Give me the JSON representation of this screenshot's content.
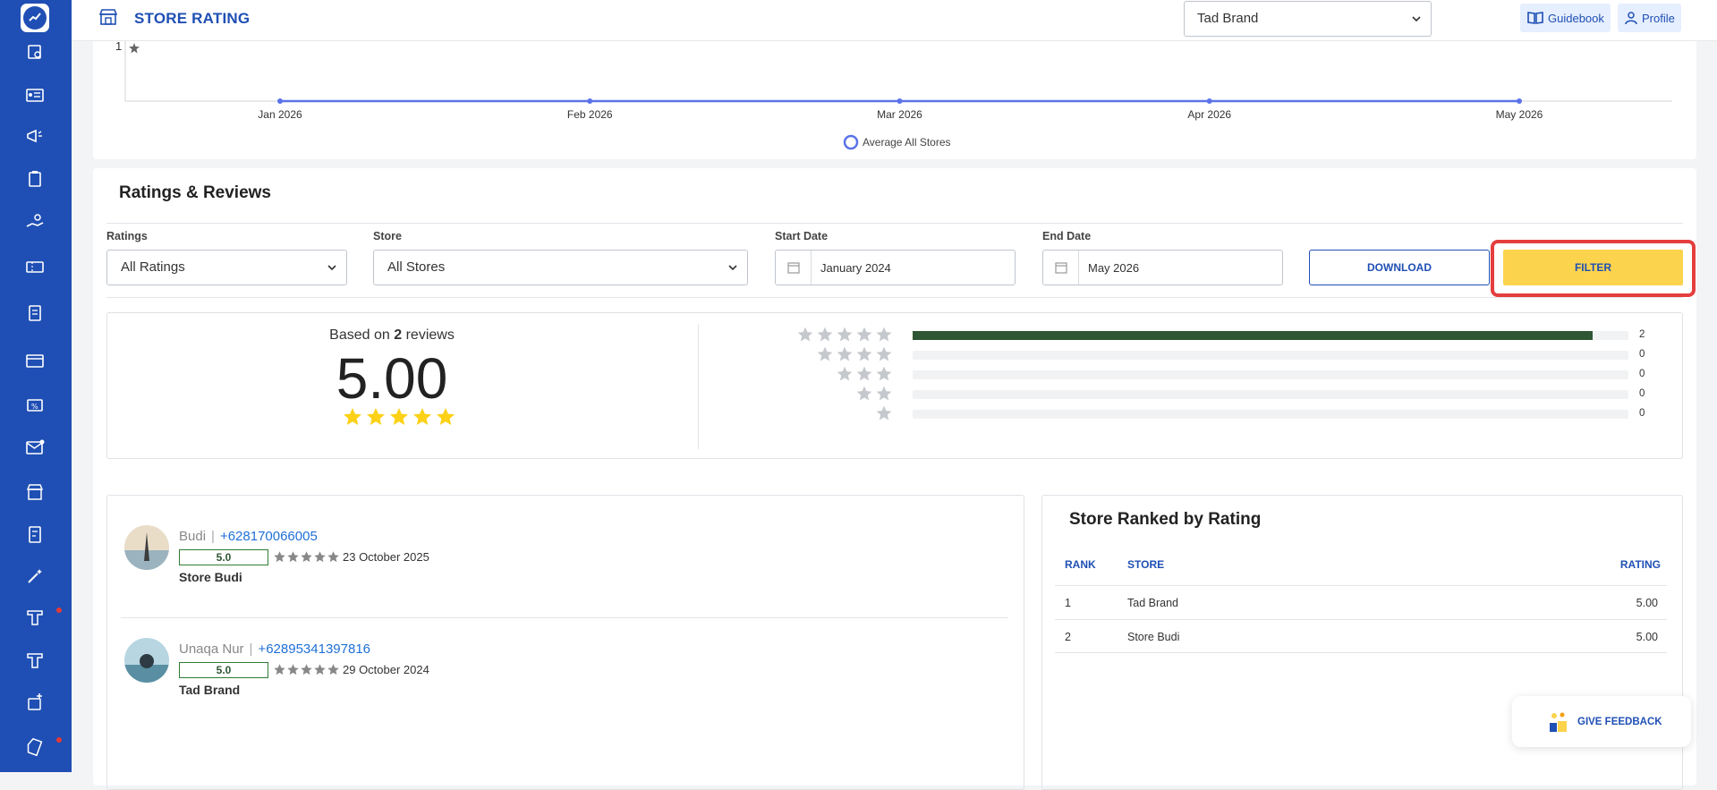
{
  "header": {
    "title": "STORE RATING",
    "brand_select": "Tad Brand",
    "guidebook": "Guidebook",
    "profile": "Profile"
  },
  "chart_data": {
    "type": "line",
    "x": [
      "Jan 2026",
      "Feb 2026",
      "Mar 2026",
      "Apr 2026",
      "May 2026"
    ],
    "series": [
      {
        "name": "Average All Stores",
        "values": [
          0,
          0,
          0,
          0,
          0
        ]
      }
    ],
    "y_tick_visible": "1",
    "color": "#5b73e8",
    "legend_position": "bottom"
  },
  "reviews": {
    "title": "Ratings & Reviews",
    "filters": {
      "ratings_label": "Ratings",
      "ratings_value": "All Ratings",
      "store_label": "Store",
      "store_value": "All Stores",
      "start_label": "Start Date",
      "start_value": "January 2024",
      "end_label": "End Date",
      "end_value": "May 2026",
      "download": "DOWNLOAD",
      "filter": "FILTER"
    },
    "summary": {
      "based_prefix": "Based on ",
      "count": "2",
      "based_suffix": " reviews",
      "score": "5.00"
    },
    "distribution": [
      {
        "stars": 5,
        "count": "2",
        "fraction": 0.95
      },
      {
        "stars": 4,
        "count": "0",
        "fraction": 0
      },
      {
        "stars": 3,
        "count": "0",
        "fraction": 0
      },
      {
        "stars": 2,
        "count": "0",
        "fraction": 0
      },
      {
        "stars": 1,
        "count": "0",
        "fraction": 0
      }
    ],
    "list": [
      {
        "name": "Budi",
        "phone": "+628170066005",
        "score": "5.0",
        "date": "23 October 2025",
        "store": "Store Budi"
      },
      {
        "name": "Unaqa Nur",
        "phone": "+62895341397816",
        "score": "5.0",
        "date": "29 October 2024",
        "store": "Tad Brand"
      }
    ]
  },
  "ranked": {
    "title": "Store Ranked by Rating",
    "headers": {
      "rank": "RANK",
      "store": "STORE",
      "rating": "RATING"
    },
    "rows": [
      {
        "rank": "1",
        "store": "Tad Brand",
        "rating": "5.00"
      },
      {
        "rank": "2",
        "store": "Store Budi",
        "rating": "5.00"
      }
    ]
  },
  "feedback": "GIVE FEEDBACK",
  "sidebar": {
    "icons": [
      "calendar-icon",
      "id-card-icon",
      "megaphone-icon",
      "clipboard-icon",
      "hand-coin-icon",
      "voucher-icon",
      "document-icon",
      "card-icon",
      "ticket-icon",
      "mail-icon",
      "store-icon",
      "receipt-icon",
      "magic-wand-icon",
      "tt-icon",
      "tt-icon",
      "user-add-icon",
      "tag-icon"
    ]
  }
}
